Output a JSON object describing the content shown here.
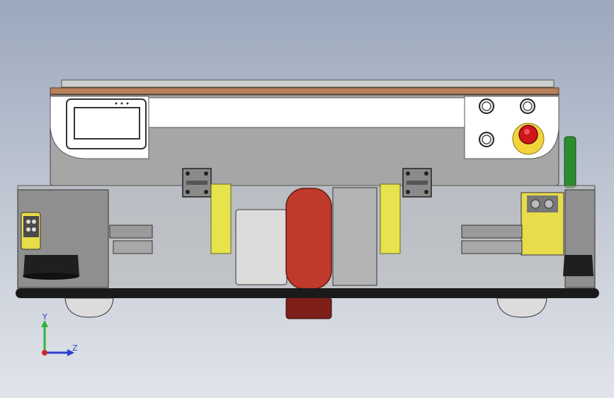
{
  "viewport": {
    "background_top": "#9ba8bd",
    "background_bottom": "#e1e4ea"
  },
  "model": {
    "panel_color": "#a7a7a7",
    "frame_color": "#bcbcbc",
    "top_plate_color": "#b8815a",
    "drive_wheel_color": "#c0392b",
    "spring_color": "#e6e34c",
    "sensor_color": "#e9dc4a",
    "green_light_color": "#2e8b2e",
    "estop_color": "#d0161b",
    "bumper_color": "#1a1a1a"
  },
  "triad": {
    "y_label": "Y",
    "z_label": "Z",
    "y_color": "#2fb33a",
    "z_color": "#2a3fd0",
    "x_color": "#d0282b"
  }
}
